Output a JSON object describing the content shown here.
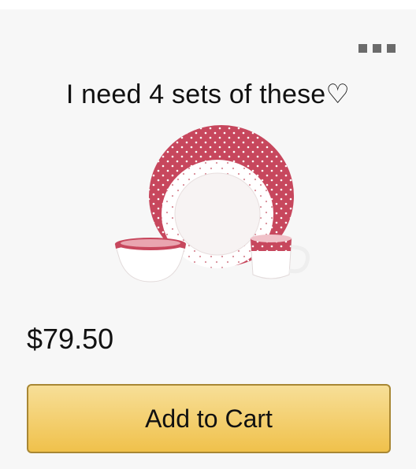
{
  "card": {
    "title": "I need 4 sets of these♡",
    "menu_icon": "more-options-icon",
    "image": {
      "subject": "dinnerware-set-image",
      "accent_color": "#c7475d"
    },
    "price": "$79.50",
    "add_to_cart_label": "Add to Cart"
  },
  "colors": {
    "button_top": "#f7df98",
    "button_bottom": "#f0c14b",
    "button_border": "#a88734"
  }
}
